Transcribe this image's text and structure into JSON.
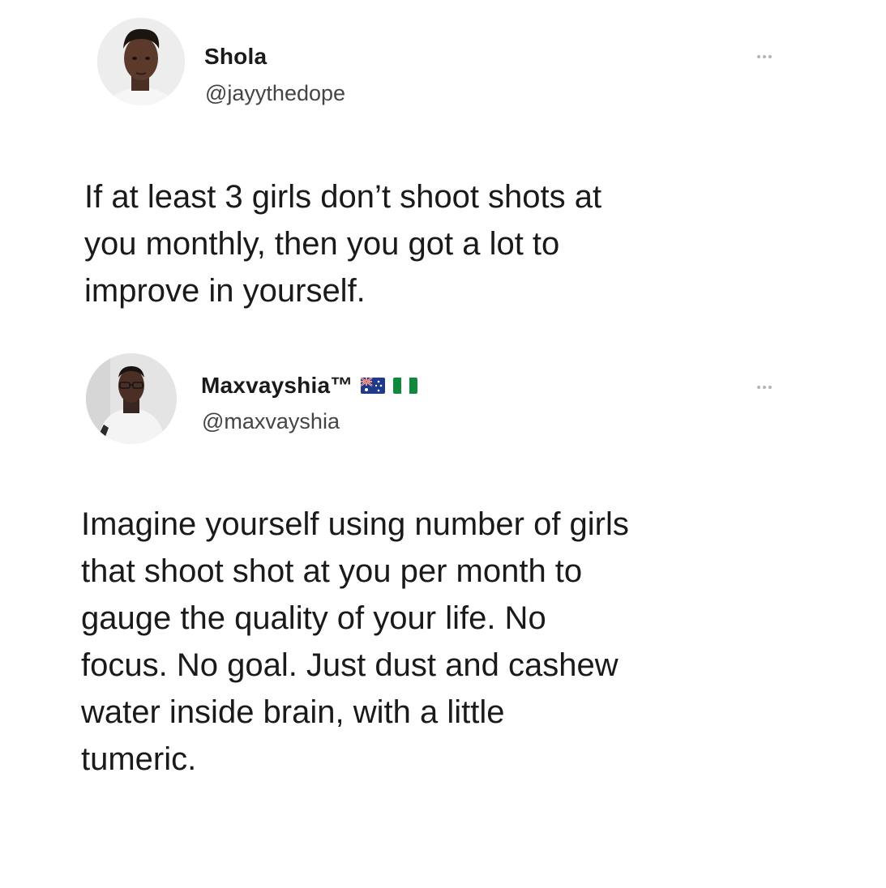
{
  "tweets": [
    {
      "display_name": "Shola",
      "handle": "@jayythedope",
      "text": "If at least 3 girls don’t shoot shots at\nyou monthly, then you got a lot to\nimprove in yourself."
    },
    {
      "display_name": "Maxvayshia™",
      "handle": "@maxvayshia",
      "flags": [
        "australia-flag",
        "nigeria-flag"
      ],
      "text": "Imagine yourself using number of girls\nthat shoot shot at you per month to\ngauge the quality of your life. No\nfocus. No goal. Just dust and cashew\nwater inside brain, with a little\ntumeric."
    }
  ],
  "icons": {
    "more": "more-options-icon"
  },
  "colors": {
    "text": "#1a1a1a",
    "handle": "#444444",
    "more_dots": "#b5b5b5",
    "background": "#ffffff"
  }
}
